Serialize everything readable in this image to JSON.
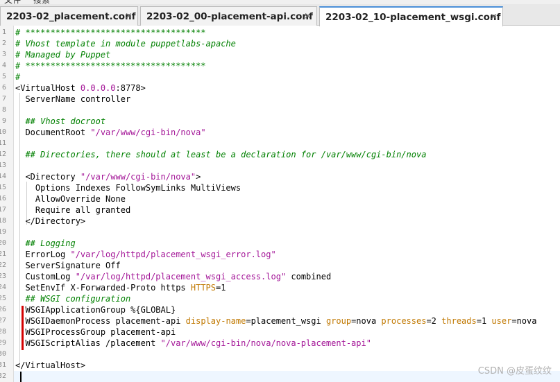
{
  "menu": {
    "items": [
      "文件",
      "搜索"
    ]
  },
  "tabs": [
    {
      "label": "2203-02_placement.conf",
      "close": "×",
      "active": false
    },
    {
      "label": "2203-02_00-placement-api.conf",
      "close": "×",
      "active": false
    },
    {
      "label": "2203-02_10-placement_wsgi.conf",
      "close": "×",
      "active": true
    }
  ],
  "editor": {
    "lines": [
      {
        "num": "1",
        "segs": [
          {
            "t": "c",
            "v": "# ************************************"
          }
        ]
      },
      {
        "num": "2",
        "segs": [
          {
            "t": "c",
            "v": "# Vhost template in module puppetlabs-apache"
          }
        ]
      },
      {
        "num": "3",
        "segs": [
          {
            "t": "c",
            "v": "# Managed by Puppet"
          }
        ]
      },
      {
        "num": "4",
        "segs": [
          {
            "t": "c",
            "v": "# ************************************"
          }
        ]
      },
      {
        "num": "5",
        "segs": [
          {
            "t": "c",
            "v": "#"
          }
        ]
      },
      {
        "num": "6",
        "segs": [
          {
            "t": "p",
            "v": "<VirtualHost "
          },
          {
            "t": "n",
            "v": "0.0.0.0"
          },
          {
            "t": "p",
            "v": ":8778>"
          }
        ]
      },
      {
        "num": "7",
        "segs": [
          {
            "t": "p",
            "v": "  ServerName controller"
          }
        ]
      },
      {
        "num": "8",
        "segs": []
      },
      {
        "num": "9",
        "segs": [
          {
            "t": "c",
            "v": "  ## Vhost docroot"
          }
        ]
      },
      {
        "num": "10",
        "segs": [
          {
            "t": "p",
            "v": "  DocumentRoot "
          },
          {
            "t": "s",
            "v": "\"/var/www/cgi-bin/nova\""
          }
        ]
      },
      {
        "num": "11",
        "segs": []
      },
      {
        "num": "12",
        "segs": [
          {
            "t": "c",
            "v": "  ## Directories, there should at least be a declaration for /var/www/cgi-bin/nova"
          }
        ]
      },
      {
        "num": "13",
        "segs": []
      },
      {
        "num": "14",
        "segs": [
          {
            "t": "p",
            "v": "  <Directory "
          },
          {
            "t": "s",
            "v": "\"/var/www/cgi-bin/nova\""
          },
          {
            "t": "p",
            "v": ">"
          }
        ]
      },
      {
        "num": "15",
        "segs": [
          {
            "t": "p",
            "v": "    Options Indexes FollowSymLinks MultiViews"
          }
        ]
      },
      {
        "num": "16",
        "segs": [
          {
            "t": "p",
            "v": "    AllowOverride None"
          }
        ]
      },
      {
        "num": "17",
        "segs": [
          {
            "t": "p",
            "v": "    Require all granted"
          }
        ]
      },
      {
        "num": "18",
        "segs": [
          {
            "t": "p",
            "v": "  </Directory>"
          }
        ]
      },
      {
        "num": "19",
        "segs": []
      },
      {
        "num": "20",
        "segs": [
          {
            "t": "c",
            "v": "  ## Logging"
          }
        ]
      },
      {
        "num": "21",
        "segs": [
          {
            "t": "p",
            "v": "  ErrorLog "
          },
          {
            "t": "s",
            "v": "\"/var/log/httpd/placement_wsgi_error.log\""
          }
        ]
      },
      {
        "num": "22",
        "segs": [
          {
            "t": "p",
            "v": "  ServerSignature Off"
          }
        ]
      },
      {
        "num": "23",
        "segs": [
          {
            "t": "p",
            "v": "  CustomLog "
          },
          {
            "t": "s",
            "v": "\"/var/log/httpd/placement_wsgi_access.log\""
          },
          {
            "t": "p",
            "v": " combined"
          }
        ]
      },
      {
        "num": "24",
        "segs": [
          {
            "t": "p",
            "v": "  SetEnvIf X-Forwarded-Proto https "
          },
          {
            "t": "a",
            "v": "HTTPS"
          },
          {
            "t": "p",
            "v": "=1"
          }
        ]
      },
      {
        "num": "25",
        "segs": [
          {
            "t": "c",
            "v": "  ## WSGI configuration"
          }
        ]
      },
      {
        "num": "26",
        "segs": [
          {
            "t": "p",
            "v": "  WSGIApplicationGroup %{GLOBAL}"
          }
        ]
      },
      {
        "num": "27",
        "segs": [
          {
            "t": "p",
            "v": "  WSGIDaemonProcess placement-api "
          },
          {
            "t": "a",
            "v": "display-name"
          },
          {
            "t": "p",
            "v": "=placement_wsgi "
          },
          {
            "t": "a",
            "v": "group"
          },
          {
            "t": "p",
            "v": "=nova "
          },
          {
            "t": "a",
            "v": "processes"
          },
          {
            "t": "p",
            "v": "=2 "
          },
          {
            "t": "a",
            "v": "threads"
          },
          {
            "t": "p",
            "v": "=1 "
          },
          {
            "t": "a",
            "v": "user"
          },
          {
            "t": "p",
            "v": "=nova"
          }
        ]
      },
      {
        "num": "28",
        "segs": [
          {
            "t": "p",
            "v": "  WSGIProcessGroup placement-api"
          }
        ]
      },
      {
        "num": "29",
        "segs": [
          {
            "t": "p",
            "v": "  WSGIScriptAlias /placement "
          },
          {
            "t": "s",
            "v": "\"/var/www/cgi-bin/nova/nova-placement-api\""
          }
        ]
      },
      {
        "num": "30",
        "segs": []
      },
      {
        "num": "31",
        "segs": [
          {
            "t": "p",
            "v": "</VirtualHost>"
          }
        ]
      },
      {
        "num": "32",
        "segs": []
      }
    ]
  },
  "watermark": "CSDN @皮蛋纹纹"
}
